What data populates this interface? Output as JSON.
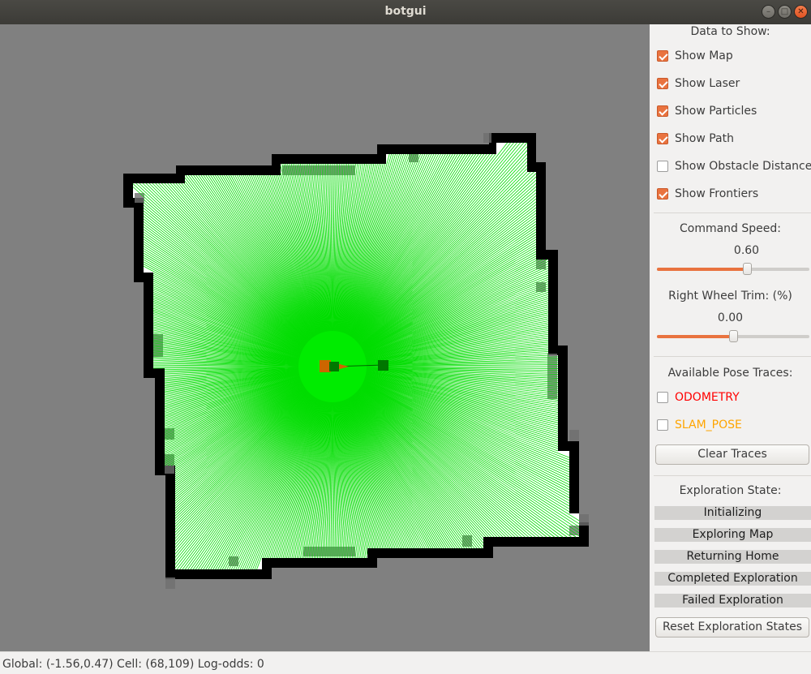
{
  "window": {
    "title": "botgui"
  },
  "panel": {
    "data_heading": "Data to Show:",
    "checkboxes": [
      {
        "label": "Show Map",
        "checked": true
      },
      {
        "label": "Show Laser",
        "checked": true
      },
      {
        "label": "Show Particles",
        "checked": true
      },
      {
        "label": "Show Path",
        "checked": true
      },
      {
        "label": "Show Obstacle Distances",
        "checked": false
      },
      {
        "label": "Show Frontiers",
        "checked": true
      }
    ],
    "speed": {
      "label": "Command Speed:",
      "value": "0.60",
      "fraction": 0.59
    },
    "trim": {
      "label": "Right Wheel Trim: (%)",
      "value": "0.00",
      "fraction": 0.5
    },
    "pose_heading": "Available Pose Traces:",
    "traces": [
      {
        "label": "ODOMETRY",
        "color": "#ff0000",
        "checked": false
      },
      {
        "label": "SLAM_POSE",
        "color": "#ffa500",
        "checked": false
      }
    ],
    "clear_traces": "Clear Traces",
    "exploration_heading": "Exploration State:",
    "states": [
      "Initializing",
      "Exploring Map",
      "Returning Home",
      "Completed Exploration",
      "Failed Exploration"
    ],
    "reset_states": "Reset Exploration States"
  },
  "status_bar": {
    "text": "Global: (-1.56,0.47) Cell: (68,109) Log-odds: 0"
  },
  "colors": {
    "canvas_bg": "#808080",
    "free_space": "#ffffff",
    "obstacle": "#000000",
    "laser": "#00dd00",
    "robot": "#cc6600",
    "accent": "#e9733f"
  }
}
